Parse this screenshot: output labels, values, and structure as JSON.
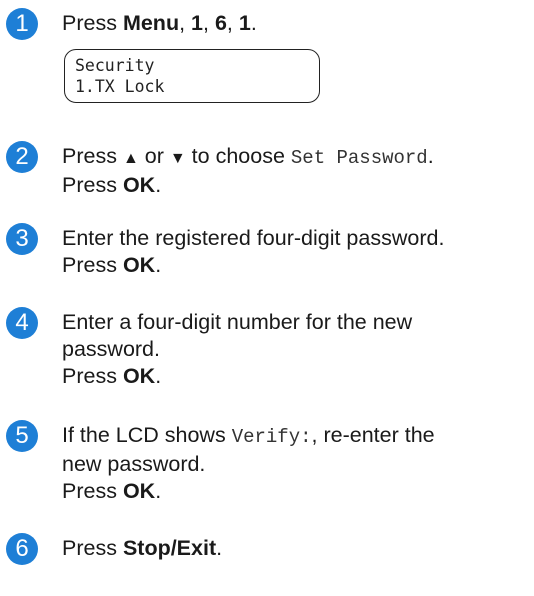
{
  "steps": [
    {
      "number": "1",
      "pre": "Press ",
      "menu": "Menu",
      "sep1": ", ",
      "k1": "1",
      "sep2": ", ",
      "k2": "6",
      "sep3": ", ",
      "k3": "1",
      "post": "."
    },
    {
      "number": "2",
      "line1_pre": "Press ",
      "up_arrow": "▲",
      "line1_mid": " or ",
      "down_arrow": "▼",
      "line1_post": " to choose ",
      "option": "Set Password",
      "line1_end": ".",
      "line2_pre": "Press ",
      "line2_key": "OK",
      "line2_post": "."
    },
    {
      "number": "3",
      "line1": "Enter the registered four-digit password.",
      "line2_pre": "Press ",
      "line2_key": "OK",
      "line2_post": "."
    },
    {
      "number": "4",
      "line1": "Enter a four-digit number for the new",
      "line2": "password.",
      "line3_pre": "Press ",
      "line3_key": "OK",
      "line3_post": "."
    },
    {
      "number": "5",
      "line1_pre": "If the LCD shows ",
      "lcd_text": "Verify:",
      "line1_post": ", re-enter the",
      "line2": "new password.",
      "line3_pre": "Press ",
      "line3_key": "OK",
      "line3_post": "."
    },
    {
      "number": "6",
      "pre": "Press ",
      "key": "Stop/Exit",
      "post": "."
    }
  ],
  "lcd": {
    "line1": "Security",
    "line2": "1.TX Lock"
  },
  "colors": {
    "badge": "#1e7fd6"
  }
}
